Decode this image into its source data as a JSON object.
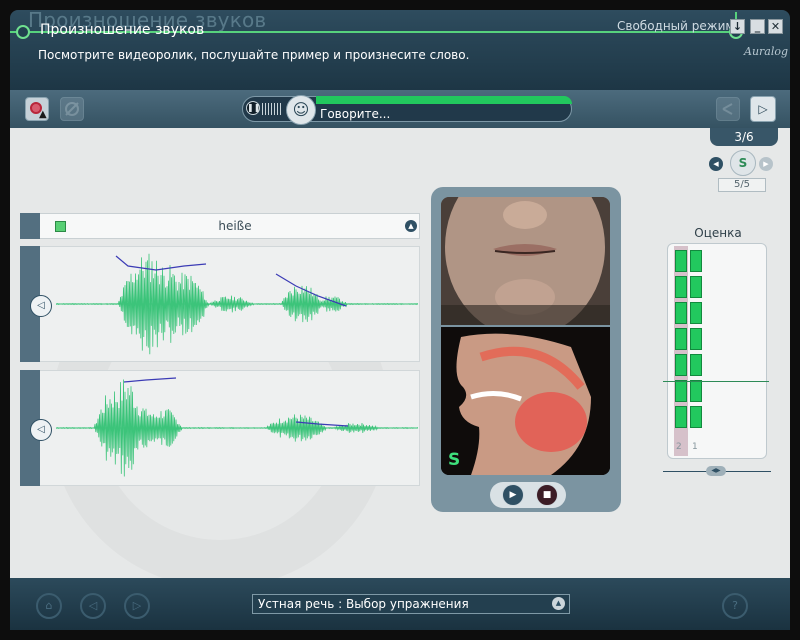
{
  "header": {
    "lesson_title": "Произношение звуков",
    "ghost_title": "Произношение звуков",
    "instruction": "Посмотрите видеоролик, послушайте пример и произнесите слово.",
    "mode_label": "Свободный режим",
    "brand": "Auralog",
    "window_buttons": [
      "↓",
      "_",
      "✕"
    ]
  },
  "toolbar": {
    "status_text": "Говорите...",
    "icons": [
      "record-icon",
      "settings-icon",
      "speaker-icon",
      "share-icon",
      "next-icon"
    ]
  },
  "exercise": {
    "counter": "3/6",
    "sound_badge": "S",
    "sub_counter": "5/5",
    "word": "heiße"
  },
  "video": {
    "sound_letter": "S"
  },
  "rating": {
    "title": "Оценка",
    "column_labels": [
      "2",
      "1"
    ],
    "column_levels": [
      7,
      7
    ]
  },
  "footer": {
    "breadcrumb": "Устная речь : Выбор упражнения"
  },
  "colors": {
    "accent_green": "#22c85e",
    "header_bg": "#2e4c5e",
    "main_bg": "#e6e8e8",
    "wave_green": "#3cc47a",
    "pitch_blue": "#3b3bb5"
  }
}
